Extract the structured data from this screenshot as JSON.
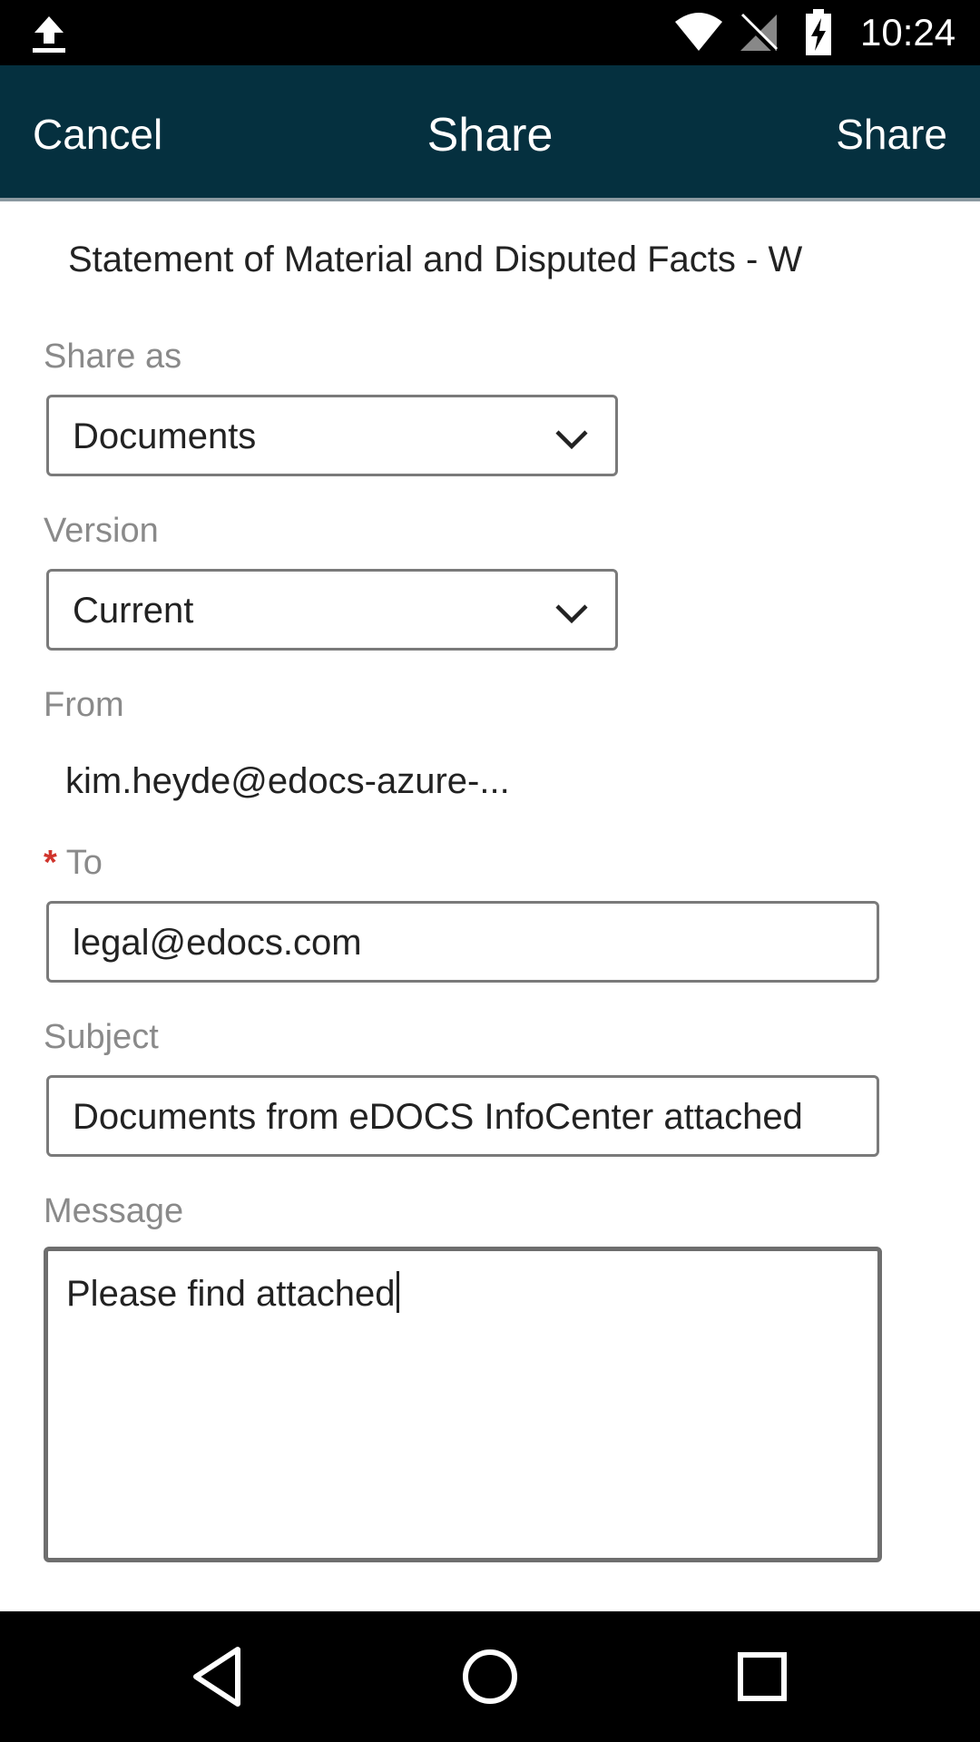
{
  "status_bar": {
    "time": "10:24",
    "icons": [
      "upload-icon",
      "wifi-icon",
      "no-signal-icon",
      "battery-charging-icon"
    ]
  },
  "app_bar": {
    "cancel_label": "Cancel",
    "title": "Share",
    "share_label": "Share",
    "background_color": "#05303f"
  },
  "document": {
    "name": "Statement of Material and Disputed Facts - W"
  },
  "form": {
    "share_as": {
      "label": "Share as",
      "value": "Documents"
    },
    "version": {
      "label": "Version",
      "value": "Current"
    },
    "from": {
      "label": "From",
      "value": "kim.heyde@edocs-azure-..."
    },
    "to": {
      "required_marker": "*",
      "label": "To",
      "value": "legal@edocs.com"
    },
    "subject": {
      "label": "Subject",
      "value": "Documents from eDOCS InfoCenter attached"
    },
    "message": {
      "label": "Message",
      "value": "Please find attached"
    }
  },
  "nav_bar": {
    "buttons": [
      "back-icon",
      "home-icon",
      "recents-icon"
    ]
  },
  "colors": {
    "required": "#d0342c",
    "label_gray": "#8a8a8a"
  }
}
